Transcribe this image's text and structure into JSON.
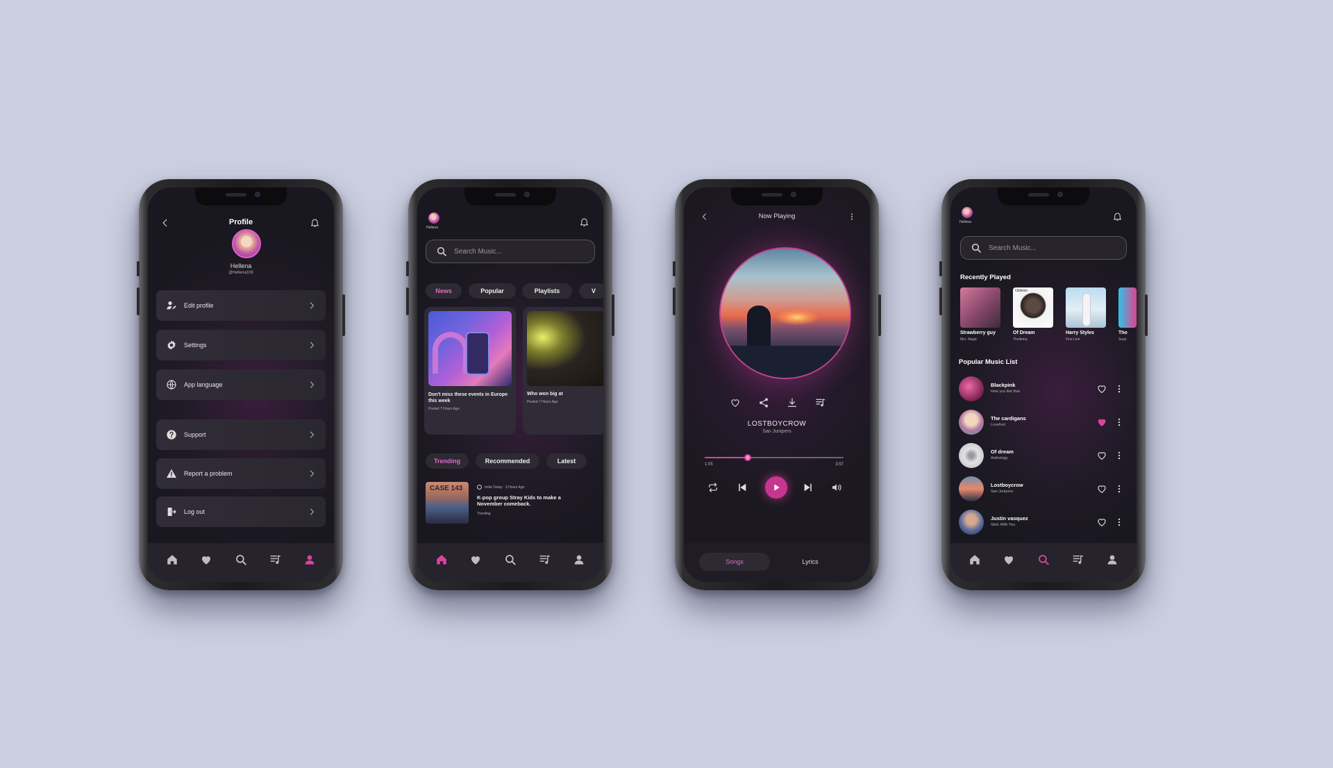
{
  "colors": {
    "background": "#cccfe1",
    "accent": "#d9449f",
    "surface": "#2d2a33",
    "screen": "#1f1b26"
  },
  "profile": {
    "title": "Profile",
    "name": "Hellena",
    "handle": "@hellena108",
    "menu": [
      {
        "label": "Edit profile",
        "icon": "edit-profile-icon"
      },
      {
        "label": "Settings",
        "icon": "gear-icon"
      },
      {
        "label": "App language",
        "icon": "globe-icon"
      },
      {
        "label": "Support",
        "icon": "question-icon"
      },
      {
        "label": "Report a problem",
        "icon": "warning-icon"
      },
      {
        "label": "Log out",
        "icon": "logout-icon"
      }
    ]
  },
  "home": {
    "user_label": "Hellena",
    "search_placeholder": "Search Music...",
    "tabs": [
      "News",
      "Popular",
      "Playlists",
      "V"
    ],
    "cards": [
      {
        "title": "Don't miss these events in Europe this week",
        "meta": "Posted 7 Hours Ago"
      },
      {
        "title": "Who won big at",
        "meta": "Posted 7 Hours Ago"
      }
    ],
    "filters": [
      "Trending",
      "Recommended",
      "Latest"
    ],
    "news_item": {
      "source": "India Today · 3 Hours Ago",
      "title_line1": "K-pop group Stray Kids to make a",
      "title_line2": "November comeback.",
      "tag": "Trending",
      "poster_text": "CASE 143"
    }
  },
  "player": {
    "title": "Now Playing",
    "artist": "LOSTBOYCROW",
    "song": "San Junipero",
    "progress": 0.31,
    "elapsed": "1:05",
    "duration": "3:57",
    "tabs": [
      "Songs",
      "Lyrics"
    ]
  },
  "search": {
    "user_label": "Hellena",
    "search_placeholder": "Search Music...",
    "recent_title": "Recently Played",
    "recent": [
      {
        "title": "Strawberry guy",
        "sub": "Mrs. Magic"
      },
      {
        "title": "Of Dream",
        "sub": "Thellema",
        "image_text": "Oblivion"
      },
      {
        "title": "Harry Styles",
        "sub": "Fine Line"
      },
      {
        "title": "Tho",
        "sub": "Susp"
      }
    ],
    "popular_title": "Popular Music List",
    "popular": [
      {
        "title": "Blackpink",
        "sub": "How you like that",
        "liked": false
      },
      {
        "title": "The cardigans",
        "sub": "Lovefool",
        "liked": true
      },
      {
        "title": "Of dream",
        "sub": "Anthology",
        "liked": false
      },
      {
        "title": "Lostboycrow",
        "sub": "San Junipero",
        "liked": false
      },
      {
        "title": "Justin vasquez",
        "sub": "Stick With You",
        "liked": false
      }
    ]
  }
}
